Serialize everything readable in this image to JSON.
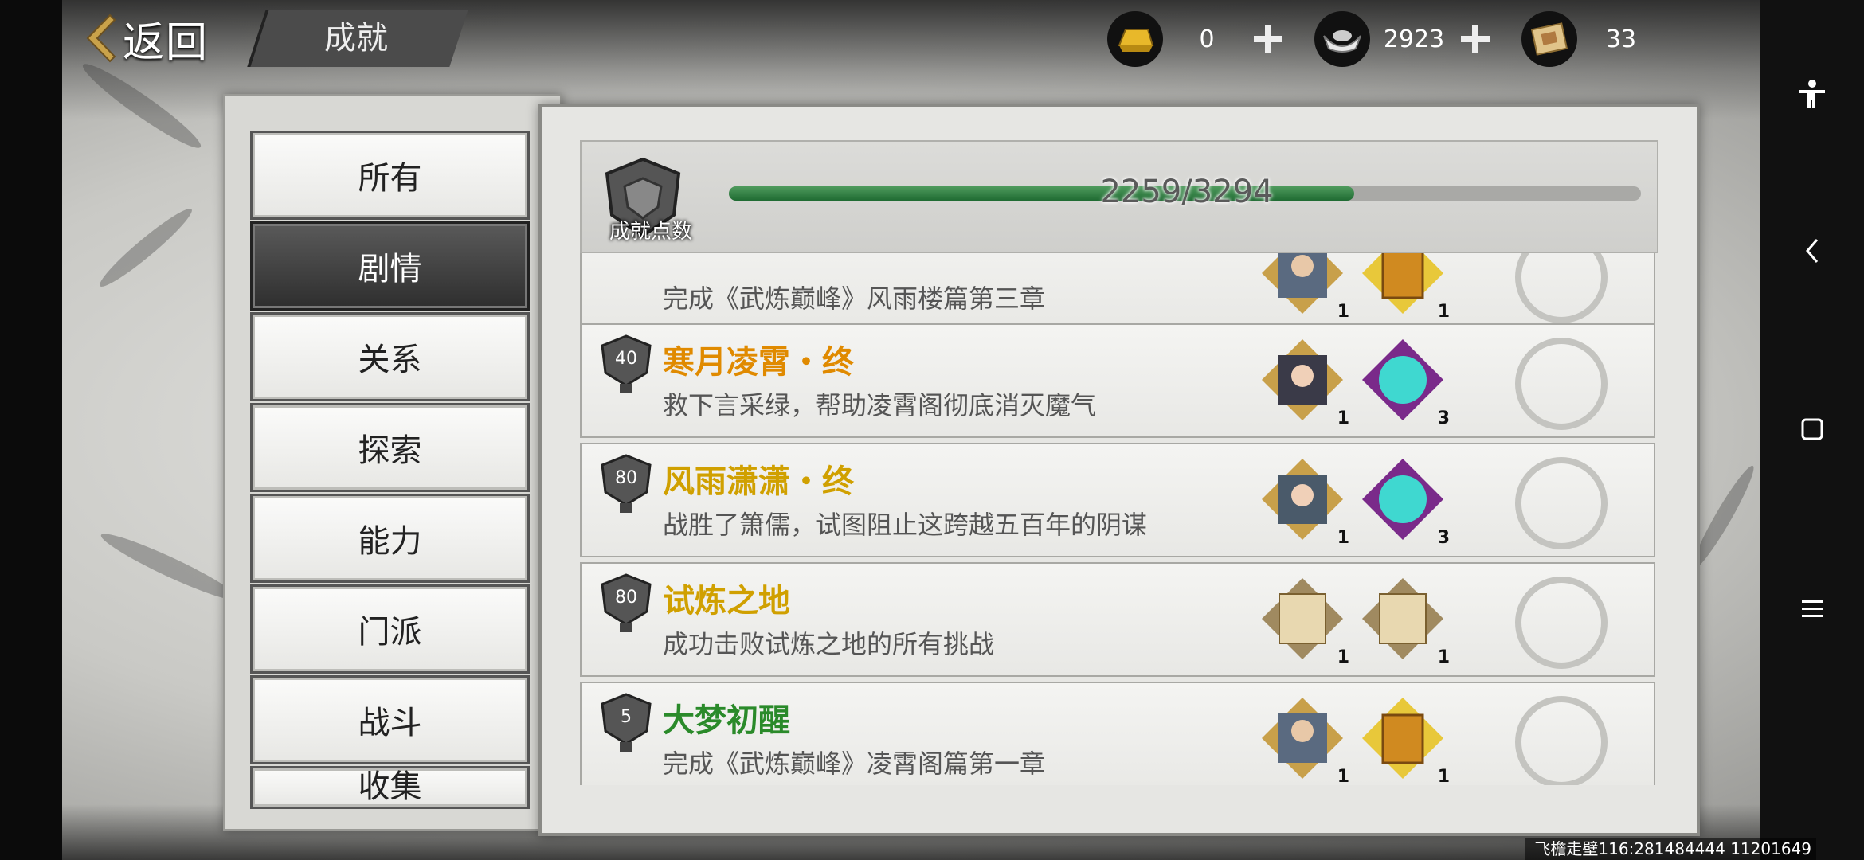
{
  "header": {
    "back_label": "返回",
    "title": "成就",
    "currencies": [
      {
        "icon": "gold-ingot-icon",
        "value": "0"
      },
      {
        "icon": "silver-ingot-icon",
        "value": "2923"
      },
      {
        "icon": "scroll-ticket-icon",
        "value": "33"
      }
    ]
  },
  "categories": [
    "所有",
    "剧情",
    "关系",
    "探索",
    "能力",
    "门派",
    "战斗",
    "收集"
  ],
  "active_category": "剧情",
  "progress": {
    "label": "成就点数",
    "current": 2259,
    "total": 3294,
    "text": "2259/3294"
  },
  "achievements": [
    {
      "points": "",
      "title": "",
      "title_color": "#2a8a2a",
      "desc": "完成《武炼巅峰》风雨楼篇第三章",
      "rewards": [
        {
          "icon": "character-portrait-icon",
          "count": "1"
        },
        {
          "icon": "gold-book-icon",
          "count": "1"
        }
      ],
      "status": "已领取"
    },
    {
      "points": "40",
      "title": "寒月凌霄・终",
      "title_color": "#e08a00",
      "desc": "救下言采绿，帮助凌霄阁彻底消灭魔气",
      "rewards": [
        {
          "icon": "character-portrait-icon",
          "count": "1"
        },
        {
          "icon": "cyan-orb-icon",
          "count": "3"
        }
      ],
      "status": "已领取"
    },
    {
      "points": "80",
      "title": "风雨潇潇・终",
      "title_color": "#d0a000",
      "desc": "战胜了箫儒，试图阻止这跨越五百年的阴谋",
      "rewards": [
        {
          "icon": "character-portrait-icon",
          "count": "1"
        },
        {
          "icon": "cyan-orb-icon",
          "count": "3"
        }
      ],
      "status": "已领取"
    },
    {
      "points": "80",
      "title": "试炼之地",
      "title_color": "#d0a000",
      "desc": "成功击败试炼之地的所有挑战",
      "rewards": [
        {
          "icon": "martial-scroll-icon",
          "count": "1"
        },
        {
          "icon": "martial-scroll-icon",
          "count": "1"
        }
      ],
      "status": "已领取"
    },
    {
      "points": "5",
      "title": "大梦初醒",
      "title_color": "#2a8a2a",
      "desc": "完成《武炼巅峰》凌霄阁篇第一章",
      "rewards": [
        {
          "icon": "character-portrait-icon",
          "count": "1"
        },
        {
          "icon": "gold-book-icon",
          "count": "1"
        }
      ],
      "status": "已领取"
    }
  ],
  "watermark": "飞檐走壁116:281484444 11201649",
  "colors": {
    "accent_green": "#2f8a45",
    "panel": "#e6e6e3"
  }
}
